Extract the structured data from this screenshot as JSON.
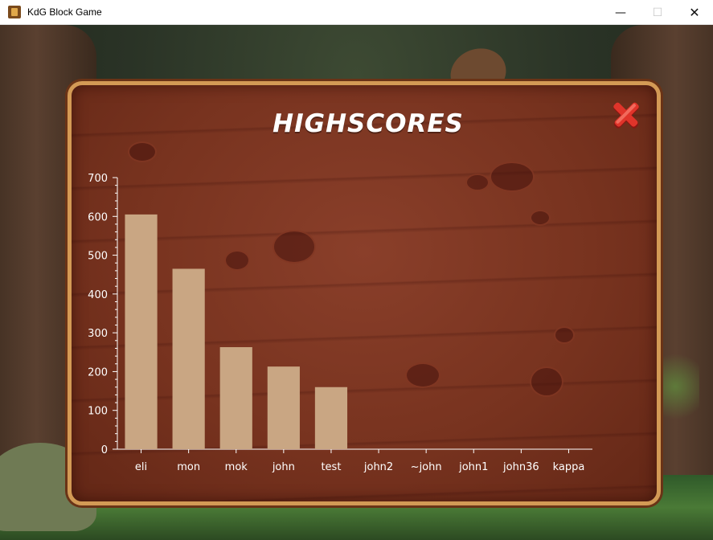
{
  "window": {
    "title": "KdG Block Game",
    "minimize_glyph": "—",
    "maximize_glyph": "☐",
    "close_glyph": "✕"
  },
  "dialog": {
    "title": "HIGHSCORES",
    "close_icon": "red-x-icon"
  },
  "colors": {
    "bar": "#c9a683",
    "axis": "#ffffff",
    "board": "#78331f",
    "board_border": "#d39a55",
    "close_red": "#d92b22"
  },
  "chart_data": {
    "type": "bar",
    "categories": [
      "eli",
      "mon",
      "mok",
      "john",
      "test",
      "john2",
      "~john",
      "john1",
      "john36",
      "kappa"
    ],
    "values": [
      605,
      465,
      263,
      213,
      160,
      0,
      0,
      0,
      0,
      0
    ],
    "ylim": [
      0,
      700
    ],
    "yticks": [
      0,
      100,
      200,
      300,
      400,
      500,
      600,
      700
    ],
    "title": "",
    "xlabel": "",
    "ylabel": "",
    "grid": false,
    "legend": "none"
  }
}
